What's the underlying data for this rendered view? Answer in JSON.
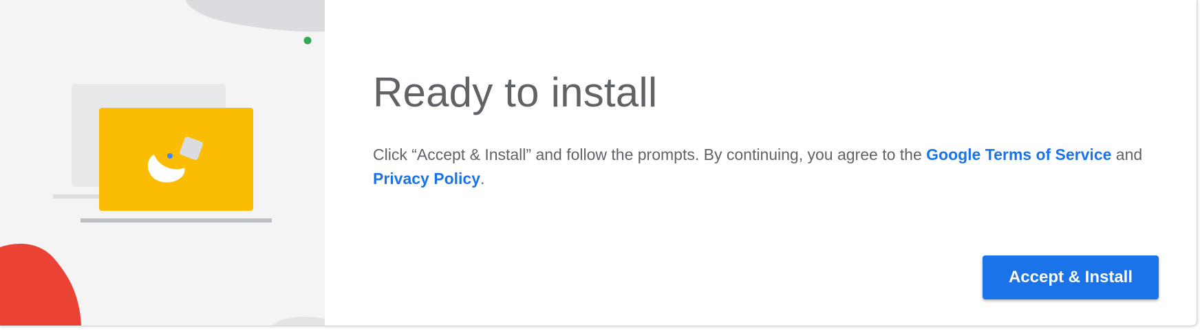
{
  "dialog": {
    "title": "Ready to install",
    "body": {
      "text_before": "Click “Accept & Install” and follow the prompts. By continuing, you agree to the ",
      "terms_link": "Google Terms of Service",
      "text_middle": " and ",
      "privacy_link": "Privacy Policy",
      "text_after": "."
    },
    "accept_button_label": "Accept & Install"
  },
  "colors": {
    "accent": "#1a73e8",
    "title_text": "#5f6368",
    "illustration_bg": "#f4f4f4",
    "laptop_yellow": "#fbbc04",
    "blob_red": "#ea4335",
    "dot_green": "#34a853"
  },
  "icons": {
    "illustration": "laptop-install-illustration"
  }
}
